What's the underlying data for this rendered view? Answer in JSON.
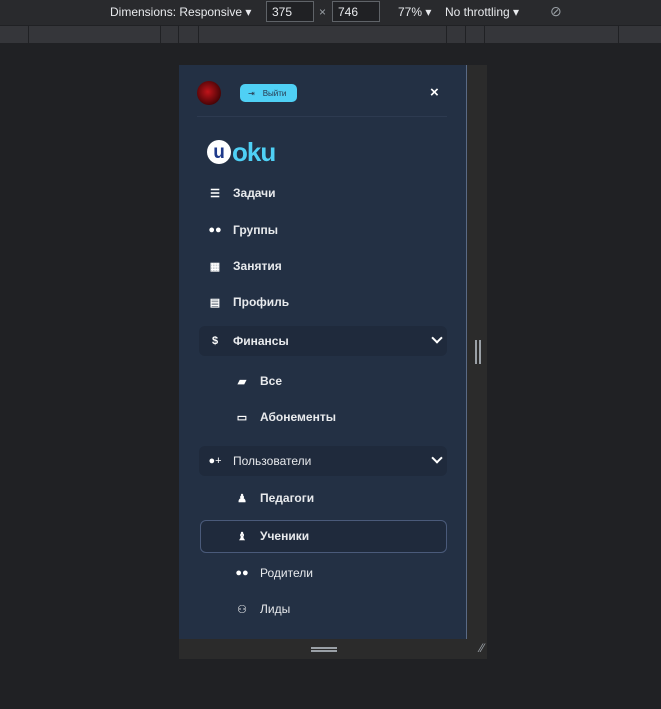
{
  "devtools": {
    "dimensions_label": "Dimensions: Responsive ▾",
    "width": "375",
    "times": "×",
    "height": "746",
    "zoom": "77% ▾",
    "throttling": "No throttling ▾",
    "rotate_icon": "rotate-icon"
  },
  "header": {
    "logout_label": "Выйти",
    "close": "×"
  },
  "logo": {
    "letter": "u",
    "rest": "oku"
  },
  "menu": [
    {
      "label": "Задачи",
      "icon": "tasks-icon"
    },
    {
      "label": "Группы",
      "icon": "users-icon"
    },
    {
      "label": "Занятия",
      "icon": "table-icon"
    },
    {
      "label": "Профиль",
      "icon": "id-card-icon"
    }
  ],
  "groups": [
    {
      "label": "Финансы",
      "icon": "hand-dollar-icon",
      "expanded": true,
      "items": [
        {
          "label": "Все",
          "icon": "wallet-icon"
        },
        {
          "label": "Абонементы",
          "icon": "credit-card-icon"
        }
      ]
    },
    {
      "label": "Пользователи",
      "icon": "user-plus-icon",
      "expanded": true,
      "items": [
        {
          "label": "Педагоги",
          "icon": "teacher-icon"
        },
        {
          "label": "Ученики",
          "icon": "student-icon",
          "active": true
        },
        {
          "label": "Родители",
          "icon": "parents-icon"
        },
        {
          "label": "Лиды",
          "icon": "lead-icon"
        }
      ]
    }
  ],
  "colors": {
    "sidebar": "#233044",
    "accent": "#4fd0f5"
  }
}
